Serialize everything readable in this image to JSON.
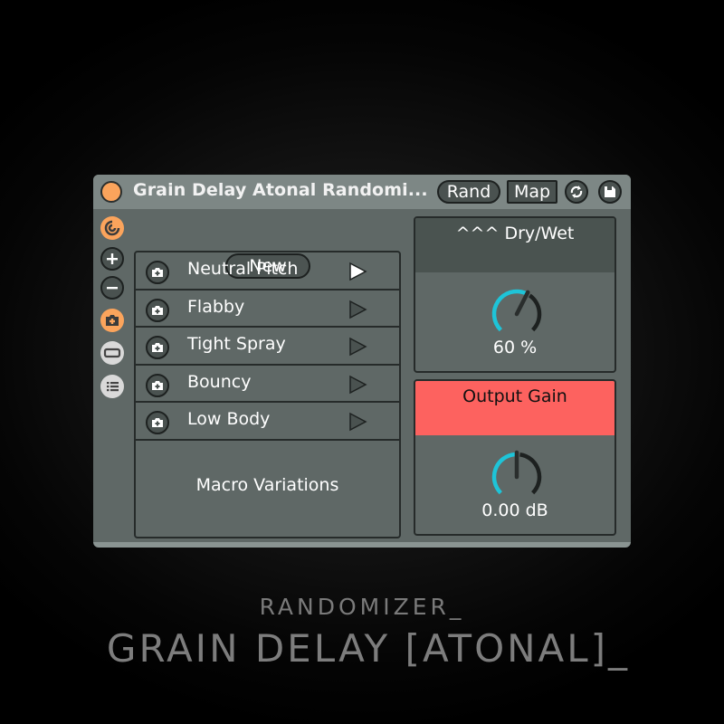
{
  "device": {
    "title": "Grain Delay Atonal Randomi...",
    "power_on": true,
    "buttons": {
      "rand": "Rand",
      "map": "Map"
    },
    "icons": {
      "sync": "sync-icon",
      "save": "save-icon"
    },
    "sidebar": [
      {
        "icon": "logo-icon",
        "active": true
      },
      {
        "icon": "plus-icon",
        "active": false
      },
      {
        "icon": "minus-icon",
        "active": false
      },
      {
        "icon": "camera-plus-icon",
        "active": true
      },
      {
        "icon": "collapse-icon",
        "active": false
      },
      {
        "icon": "list-icon",
        "active": false
      }
    ],
    "new_button": "New",
    "presets": [
      {
        "label": "Neutral Pitch",
        "active": true
      },
      {
        "label": "Flabby",
        "active": false
      },
      {
        "label": "Tight Spray",
        "active": false
      },
      {
        "label": "Bouncy",
        "active": false
      },
      {
        "label": "Low Body",
        "active": false
      }
    ],
    "section_label": "Macro Variations",
    "dry_wet": {
      "label": "^^^ Dry/Wet",
      "value_text": "60 %",
      "value_fraction": 0.6
    },
    "output_gain": {
      "label": "Output Gain",
      "value_text": "0.00 dB",
      "value_fraction": 0.5
    }
  },
  "colors": {
    "accent_orange": "#fba45c",
    "knob_arc": "#1ec4d8",
    "output_gain_header": "#fd625f"
  },
  "caption": {
    "subtitle": "RANDOMIZER_",
    "title": "GRAIN DELAY [ATONAL]_"
  }
}
